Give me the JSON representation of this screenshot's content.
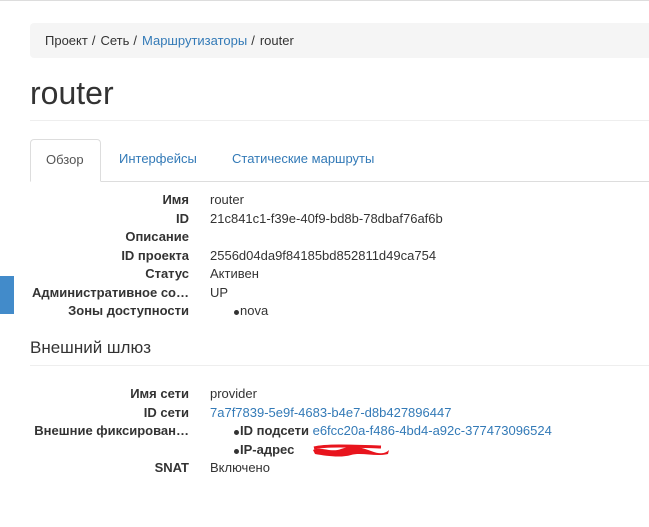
{
  "breadcrumb": {
    "items": [
      {
        "label": "Проект",
        "link": false
      },
      {
        "label": "Сеть",
        "link": false
      },
      {
        "label": "Маршрутизаторы",
        "link": true
      },
      {
        "label": "router",
        "link": false
      }
    ],
    "separator": "/"
  },
  "page_title": "router",
  "tabs": [
    {
      "label": "Обзор",
      "active": true
    },
    {
      "label": "Интерфейсы",
      "active": false
    },
    {
      "label": "Статические маршруты",
      "active": false
    }
  ],
  "overview": {
    "rows": [
      {
        "label": "Имя",
        "value": "router"
      },
      {
        "label": "ID",
        "value": "21c841c1-f39e-40f9-bd8b-78dbaf76af6b"
      },
      {
        "label": "Описание",
        "value": ""
      },
      {
        "label": "ID проекта",
        "value": "2556d04da9f84185bd852811d49ca754"
      },
      {
        "label": "Статус",
        "value": "Активен"
      },
      {
        "label": "Административное со…",
        "value": "UP"
      },
      {
        "label": "Зоны доступности",
        "list": [
          "nova"
        ]
      }
    ]
  },
  "gateway": {
    "title": "Внешний шлюз",
    "network_name_label": "Имя сети",
    "network_name": "provider",
    "network_id_label": "ID сети",
    "network_id": "7a7f7839-5e9f-4683-b4e7-d8b427896447",
    "fixed_ips_label": "Внешние фиксирован…",
    "subnet_id_label": "ID подсети",
    "subnet_id": "e6fcc20a-f486-4bd4-a92c-377473096524",
    "ip_label": "IP-адрес",
    "snat_label": "SNAT",
    "snat_value": "Включено"
  },
  "colors": {
    "link": "#337ab7",
    "redaction": "#e8141d",
    "accent": "#428bca"
  }
}
